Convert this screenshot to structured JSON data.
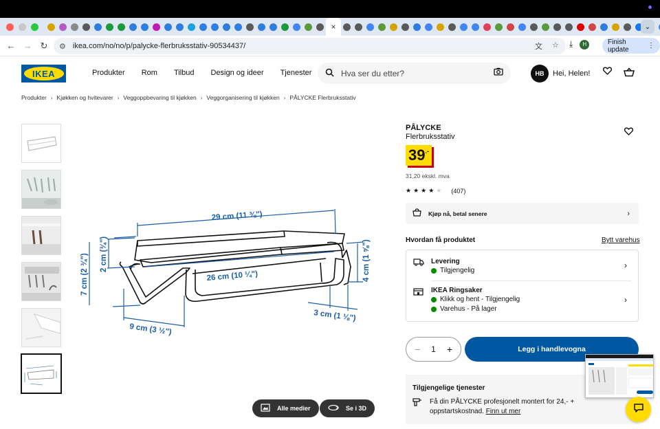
{
  "browser": {
    "url": "ikea.com/no/no/p/palycke-flerbruksstativ-90534437/",
    "finish_update_label": "Finish update",
    "profile_initial": "H",
    "tab_colors": [
      "#d6a400",
      "#b65bbf",
      "#8a8a8a",
      "#5a5a5a",
      "#2f7de0",
      "#1a9a3a",
      "#1a9a3a",
      "#2f7de0",
      "#2f7de0",
      "#c21ab5",
      "#2f7de0",
      "#2f7de0",
      "#1aa1e0",
      "#2f7de0",
      "#2f7de0",
      "#2f7de0",
      "#2f7de0",
      "#5a5a5a",
      "#2f7de0",
      "#2f7de0",
      "#1a9a3a",
      "#4285f4",
      "#5a9a3a",
      "#5a5a5a",
      "#5a5a5a",
      "#5a5a5a",
      "#4285f4",
      "#5a9a3a",
      "#d6a400",
      "#5a5a5a",
      "#2f7de0",
      "#4285f4",
      "#d6a400",
      "#5a5a5a",
      "#4285f4",
      "#4285f4",
      "#e0405a",
      "#5a9a3a",
      "#d14545",
      "#4285f4",
      "#5a5a5a",
      "#5a9a3a",
      "#5a5a5a",
      "#5a5a5a",
      "#e00000",
      "#d14545",
      "#2f7de0",
      "#d6a400",
      "#5a5a5a",
      "#1877f2",
      "#2f7de0",
      "#4285f4"
    ]
  },
  "header": {
    "logo_text": "IKEA",
    "nav": [
      "Produkter",
      "Rom",
      "Tilbud",
      "Design og ideer",
      "Tjenester"
    ],
    "search_placeholder": "Hva ser du etter?",
    "user_initials": "HB",
    "greeting": "Hei, Helen!"
  },
  "breadcrumbs": [
    "Produkter",
    "Kjøkken og hvitevarer",
    "Veggoppbevaring til kjøkken",
    "Veggorganisering til kjøkken",
    "PÅLYCKE Flerbruksstativ"
  ],
  "gallery": {
    "dimensions": {
      "top": "29 cm (11 ⅜\")",
      "inner": "26 cm (10 ¼\")",
      "left_height": "7 cm (2 ¾\")",
      "inner_height": "2 cm (¾\")",
      "right_height": "4 cm (1 ⅝\")",
      "depth_front": "9 cm (3 ½\")",
      "depth_right": "3 cm (1 ⅛\")"
    },
    "all_media_label": "Alle medier",
    "view_3d_label": "Se i 3D"
  },
  "product": {
    "name": "PÅLYCKE",
    "description": "Flerbruksstativ",
    "price_whole": "39",
    "price_suffix": ".-",
    "price_ex_vat": "31,20 ekskl. mva",
    "rating": 4,
    "rating_max": 5,
    "review_count": "(407)",
    "klarna_label": "Kjøp nå, betal senere"
  },
  "delivery": {
    "heading": "Hvordan få produktet",
    "change_store": "Bytt varehus",
    "delivery_title": "Levering",
    "delivery_status": "Tilgjengelig",
    "store_title": "IKEA Ringsaker",
    "store_line1": "Klikk og hent - Tilgjengelig",
    "store_line2": "Varehus - På lager"
  },
  "purchase": {
    "quantity": "1",
    "add_to_cart": "Legg i handlevogna"
  },
  "services": {
    "heading": "Tilgjengelige tjenester",
    "text": "Få din PÅLYCKE profesjonelt montert for ",
    "price": "24,-",
    "text2": " + oppstartskostnad. ",
    "link": "Finn ut mer"
  },
  "colors": {
    "ikea_blue": "#0058a3",
    "ikea_yellow": "#ffdb00",
    "available_green": "#0a8a00"
  }
}
